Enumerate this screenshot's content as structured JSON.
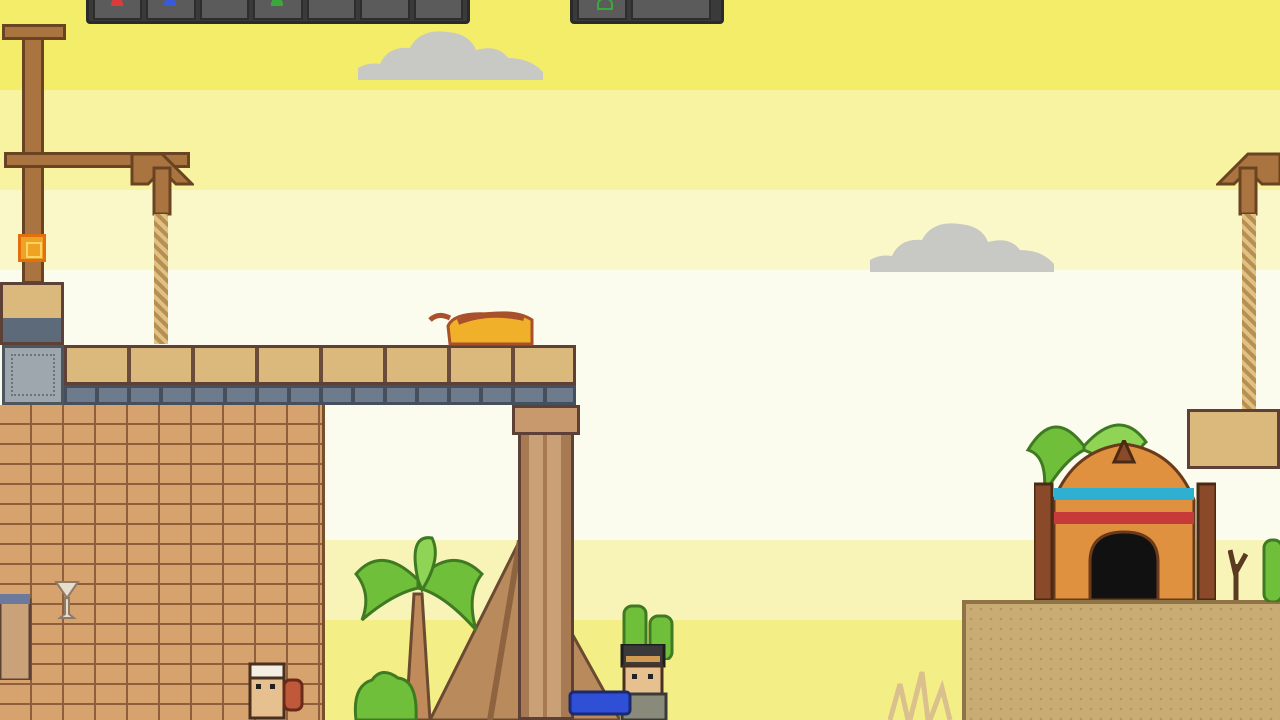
{
  "scene": "desert-platformer-level",
  "hud": {
    "left_panel_slots": 7,
    "right_panel_slots": 2,
    "gem_colors": [
      "#d93a3a",
      "#3a5bd9",
      "#3aa83a"
    ]
  },
  "colors": {
    "sky_top": "#f3ed6a",
    "sky_mid": "#fbfbee",
    "brick": "#c9935f",
    "stone": "#dbb87b",
    "wood": "#a9743f",
    "sand": "#c8ac74",
    "palm_leaf": "#6fbf3a"
  },
  "icons": {
    "coin_block": "coin-block-icon",
    "cat": "sleeping-cat-icon",
    "player": "player-character-icon",
    "cactus": "cactus-icon",
    "palm": "palm-tree-icon",
    "hut": "hut-icon",
    "pyramid": "pyramid-icon"
  }
}
